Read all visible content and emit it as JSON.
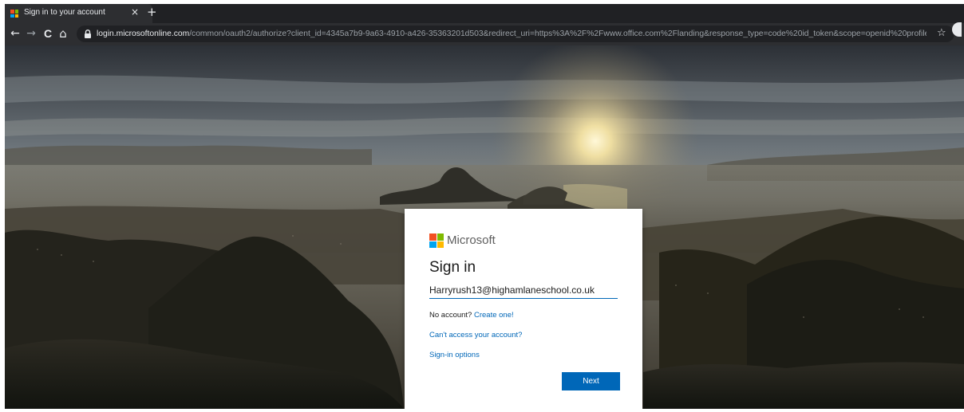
{
  "browser": {
    "tab_title": "Sign in to your account",
    "tab_close_glyph": "×",
    "new_tab_glyph": "+",
    "back_glyph": "←",
    "forward_glyph": "→",
    "reload_glyph": "C",
    "home_glyph": "⌂",
    "star_glyph": "☆",
    "url_host": "login.microsoftonline.com",
    "url_path": "/common/oauth2/authorize?client_id=4345a7b9-9a63-4910-a426-35363201d503&redirect_uri=https%3A%2F%2Fwww.office.com%2Flanding&response_type=code%20id_token&scope=openid%20profile&response_mode..."
  },
  "signin": {
    "brand": "Microsoft",
    "title": "Sign in",
    "email_value": "Harryrush13@highamlaneschool.co.uk",
    "no_account_text": "No account?",
    "create_link": "Create one!",
    "cant_access_link": "Can't access your account?",
    "signin_options_link": "Sign-in options",
    "next_label": "Next"
  },
  "colors": {
    "ms_red": "#f25022",
    "ms_green": "#7fba00",
    "ms_blue": "#00a4ef",
    "ms_yellow": "#ffb900",
    "link_blue": "#0067b8",
    "button_blue": "#0067b8"
  },
  "icons": {
    "favicon": "microsoft-logo-icon",
    "lock": "lock-icon",
    "star": "star-icon",
    "profile": "profile-icon"
  }
}
